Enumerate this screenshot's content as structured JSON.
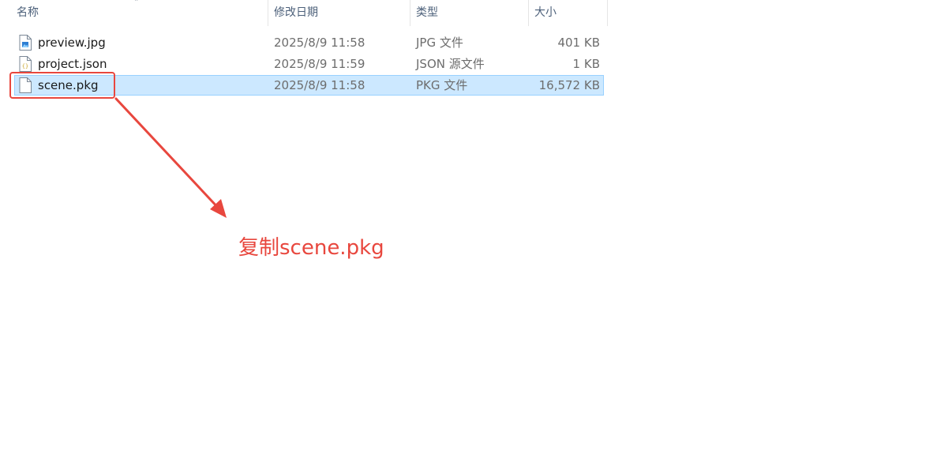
{
  "columns": {
    "name": "名称",
    "modified": "修改日期",
    "type": "类型",
    "size": "大小",
    "sort_icon": "chevron-up-icon"
  },
  "files": [
    {
      "name": "preview.jpg",
      "modified": "2025/8/9 11:58",
      "type": "JPG 文件",
      "size": "401 KB",
      "icon": "image-file-icon",
      "selected": false
    },
    {
      "name": "project.json",
      "modified": "2025/8/9 11:59",
      "type": "JSON 源文件",
      "size": "1 KB",
      "icon": "json-file-icon",
      "selected": false
    },
    {
      "name": "scene.pkg",
      "modified": "2025/8/9 11:58",
      "type": "PKG 文件",
      "size": "16,572 KB",
      "icon": "blank-file-icon",
      "selected": true
    }
  ],
  "annotation": {
    "text": "复制scene.pkg",
    "color": "#e8473e"
  },
  "colors": {
    "selection_bg": "#cce8ff",
    "selection_border": "#99d1ff",
    "header_text": "#4c607a"
  }
}
